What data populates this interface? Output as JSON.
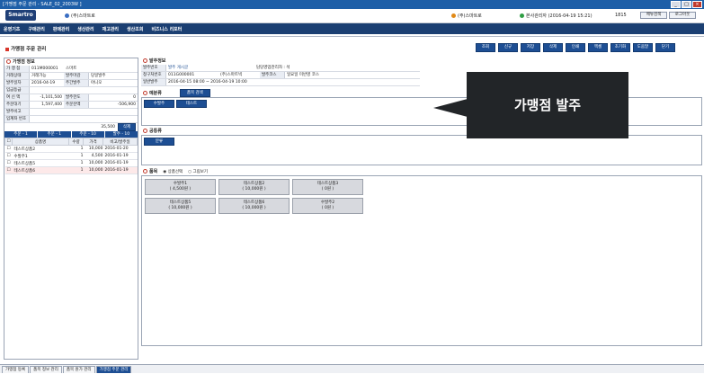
{
  "window": {
    "title": "[가맹점 주문 관리 - SALE_02_2003W ]",
    "buttons": [
      "_",
      "□",
      "×"
    ]
  },
  "header": {
    "logo": "Smartro",
    "agency": "(주)스마트로",
    "company": "(주)스마트로",
    "user": "본사관리자 (2016-04-19 15:21)",
    "version": "1815",
    "buttons": [
      "메뉴검색",
      "로그아웃"
    ]
  },
  "menu": [
    "운영기초",
    "구매관리",
    "판매관리",
    "생산관리",
    "재고관리",
    "생산조회",
    "비즈니스 리포터"
  ],
  "screen_title": "가맹점 주문 관리",
  "toolbar": [
    "조회",
    "신규",
    "저장",
    "삭제",
    "인쇄",
    "엑셀",
    "초기화",
    "도움말",
    "닫기"
  ],
  "left": {
    "section_title": "가맹점 정보",
    "rows": [
      {
        "l1": "가 맹 점",
        "v1": "011M000001",
        "v2": "스마트"
      },
      {
        "l1": "거래상태",
        "v1": "거래가능",
        "l2": "발주마감",
        "v2": "당일발주"
      },
      {
        "l1": "발주일자",
        "v1": "2016-04-19",
        "l2": "주간발주",
        "v2": "아니오"
      },
      {
        "l1": "입금등급",
        "v1": ""
      },
      {
        "l1": "여 신 액",
        "v1": "-1,101,500",
        "l2": "발주한도",
        "v2": "0"
      },
      {
        "l1": "주문대기",
        "v1": "1,597,400",
        "l2": "주문잔액",
        "v2": "-506,900"
      },
      {
        "l1": "발주비고",
        "v1": ""
      },
      {
        "l1": "입계좌 번호",
        "v1": ""
      }
    ],
    "memo_count": "35,500",
    "memo_btn": "삭제",
    "tabs": [
      "주문 - 1",
      "주문 - 1",
      "주문 - 10",
      "발주 - 10"
    ],
    "table": {
      "headers": [
        "",
        "상품명",
        "수량",
        "가격",
        "비고/발주일"
      ],
      "rows": [
        {
          "name": "테스트상품2",
          "qty": "1",
          "price": "10,000",
          "date": "2016-01-20"
        },
        {
          "name": "수발주1",
          "qty": "1",
          "price": "4,500",
          "date": "2016-01-19"
        },
        {
          "name": "테스트상품5",
          "qty": "1",
          "price": "10,000",
          "date": "2016-01-19"
        },
        {
          "name": "테스트상품6",
          "qty": "1",
          "price": "10,000",
          "date": "2016-01-19"
        }
      ]
    }
  },
  "order_info": {
    "section_title": "발주정보",
    "row1": {
      "label": "발주번호",
      "value": "발주 게시글",
      "mid": "담당영업관리자 : 석"
    },
    "row2": {
      "label": "청구처번호",
      "value": "011G000001",
      "v2": "(주)스마트빅",
      "l3": "발주코스",
      "v3": "일요일 미반영 코스"
    },
    "row3": {
      "label": "일반발주",
      "value": "2016-04-15 08:00 ~ 2016-04-19 10:00"
    }
  },
  "sections": {
    "yeobun": {
      "title": "예분류",
      "button": "품목 검색"
    },
    "yeobun_tabs": [
      "수발주",
      "테스트"
    ],
    "common": {
      "title": "공통류",
      "tab": "분류"
    },
    "items": {
      "title": "품목",
      "radio1": "상품선택",
      "radio2": "그림보기"
    }
  },
  "product_buttons": [
    "수발주1\n( 4,500원 )",
    "테스트상품2\n( 10,000원 )",
    "테스트상품3\n( 0원 )",
    "테스트상품5\n( 10,000원 )",
    "테스트상품6\n( 10,000원 )",
    "수발주2\n( 0원 )"
  ],
  "callout": "가맹점 발주",
  "taskbar": [
    "가맹점 등록",
    "품목 정보 관리",
    "품목 원가 관리",
    "가맹점 주문 관리"
  ],
  "colors": {
    "navy": "#1b3f72",
    "button": "#1d4e93",
    "callout": "#222528"
  }
}
